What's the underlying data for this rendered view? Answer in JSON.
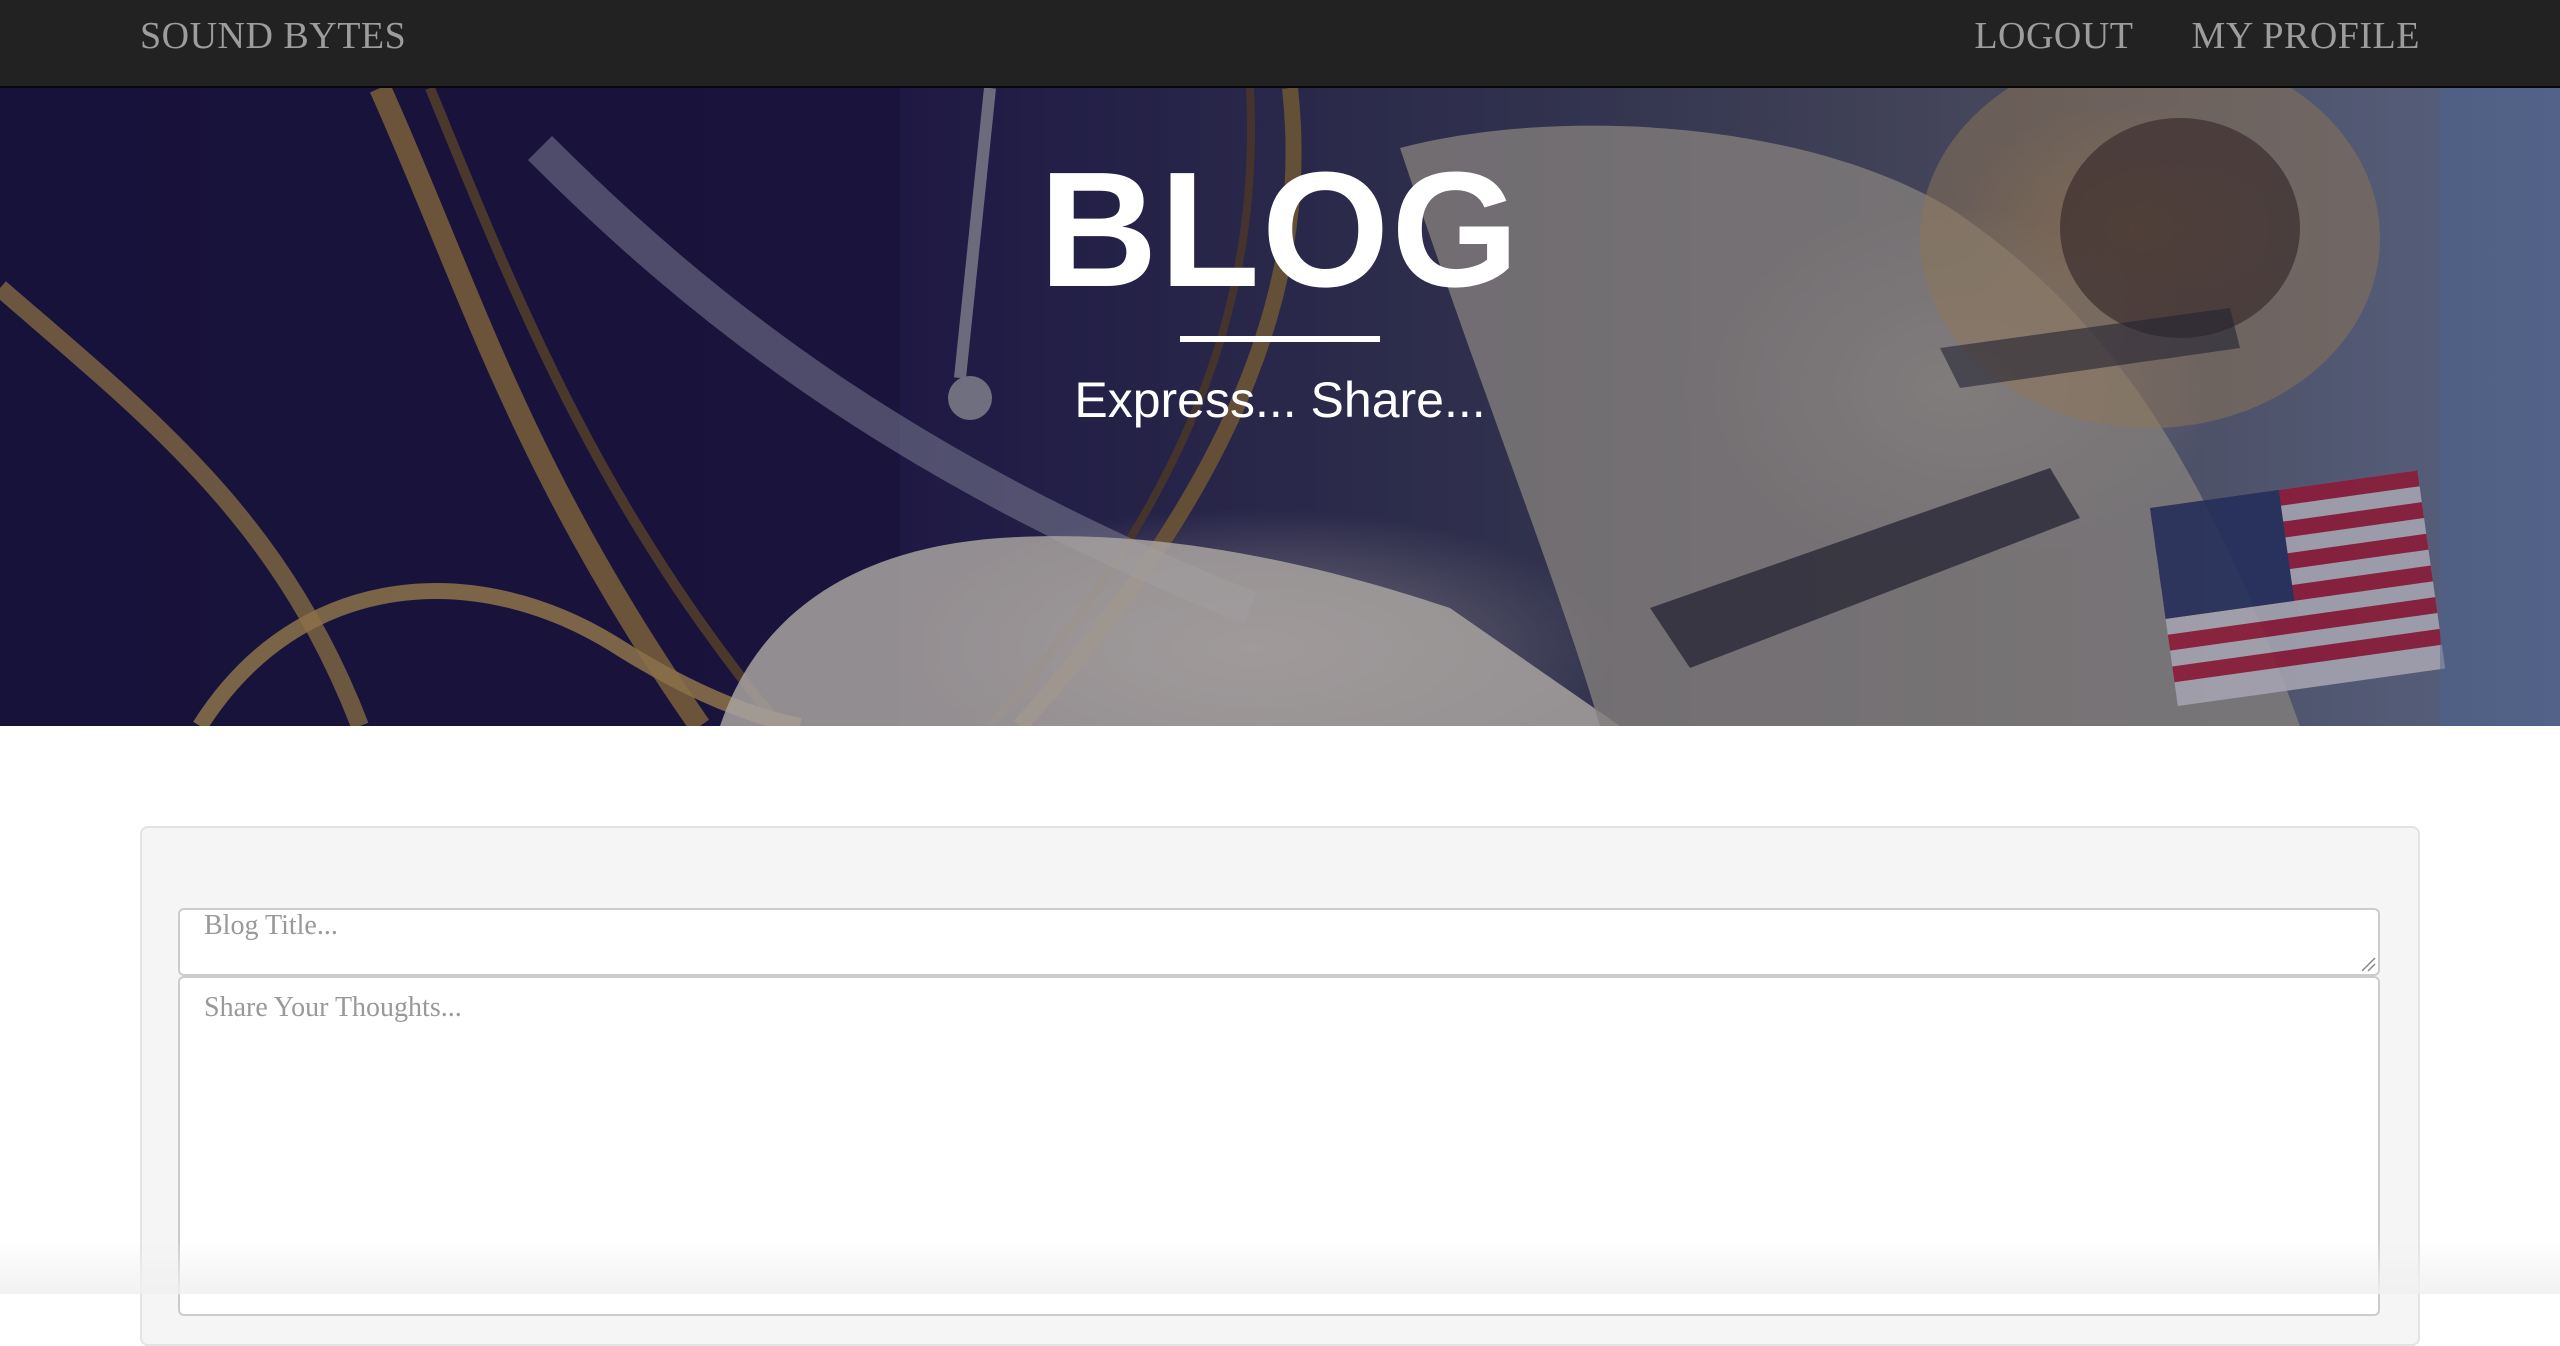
{
  "navbar": {
    "brand": "SOUND BYTES",
    "links": [
      {
        "label": "LOGOUT"
      },
      {
        "label": "MY PROFILE"
      }
    ]
  },
  "hero": {
    "title": "BLOG",
    "subtitle": "Express... Share..."
  },
  "form": {
    "title_placeholder": "Blog Title...",
    "title_value": "",
    "body_placeholder": "Share Your Thoughts...",
    "body_value": ""
  }
}
